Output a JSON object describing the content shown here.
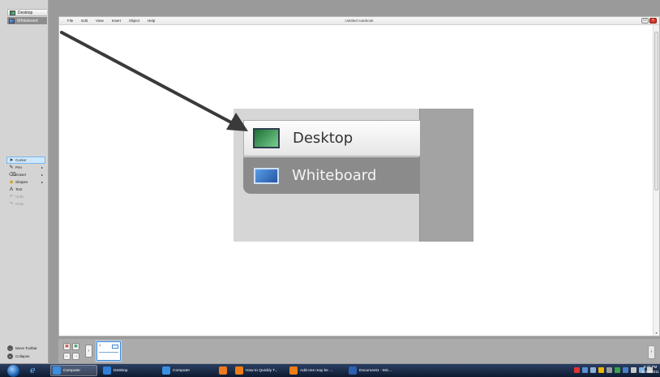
{
  "left_toolbar": {
    "modes": [
      {
        "label": "Desktop",
        "icon": "desktop-icon"
      },
      {
        "label": "Whiteboard",
        "icon": "whiteboard-icon"
      }
    ],
    "tools": [
      {
        "label": "Cursor",
        "icon": "cursor-icon",
        "active": true
      },
      {
        "label": "Pen",
        "icon": "pen-icon",
        "has_submenu": true
      },
      {
        "label": "Eraser",
        "icon": "eraser-icon",
        "has_submenu": true
      },
      {
        "label": "Shapes",
        "icon": "shapes-icon",
        "has_submenu": true
      },
      {
        "label": "Text",
        "icon": "text-icon"
      },
      {
        "label": "Undo",
        "icon": "undo-icon",
        "disabled": true
      },
      {
        "label": "Redo",
        "icon": "redo-icon",
        "disabled": true
      }
    ],
    "move_toolbar": "Move Toolbar",
    "collapse": "Collapse"
  },
  "window": {
    "menus": [
      "File",
      "Edit",
      "View",
      "Insert",
      "Object",
      "Help"
    ],
    "title": "Untitled notebook"
  },
  "zoomed_callout": {
    "desktop_label": "Desktop",
    "whiteboard_label": "Whiteboard"
  },
  "page_sorter": {
    "page_number": "1"
  },
  "taskbar": {
    "items": [
      {
        "label": "Computer",
        "active": true,
        "icon_color": "#3a8ee0"
      },
      {
        "label": "Desktop",
        "active": false,
        "icon_color": "#2f7fd6"
      },
      {
        "label": "Computer",
        "active": false,
        "icon_color": "#3a8ee0"
      },
      {
        "label": "",
        "active": false,
        "icon_color": "#f07a1f"
      },
      {
        "label": "How to Quickly T...",
        "active": false,
        "icon_color": "#ef7d15"
      },
      {
        "label": "Add-ons may be ...",
        "active": false,
        "icon_color": "#ef7d15"
      },
      {
        "label": "Document1 - Mic...",
        "active": false,
        "icon_color": "#2c5fb0"
      }
    ],
    "time": "5:20 PM",
    "date": "11/07/2011"
  },
  "colors": {
    "accent": "#3c86d6",
    "arrow": "#3a3a3a",
    "close_button": "#d8362a"
  }
}
